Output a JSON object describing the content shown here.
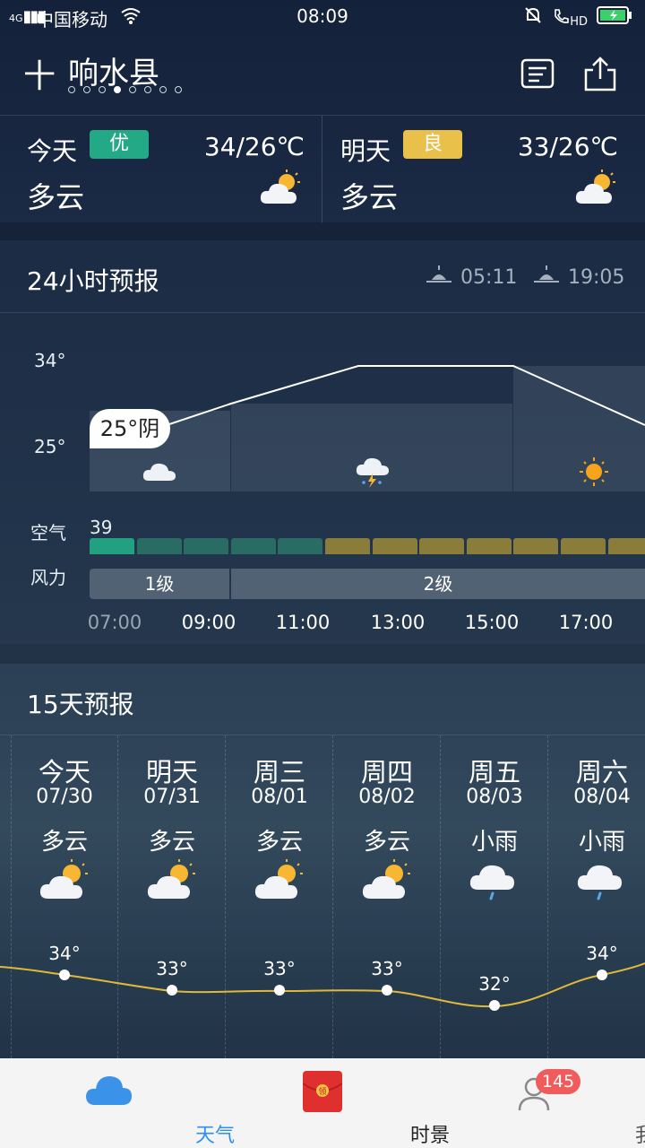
{
  "status": {
    "network": "4G",
    "carrier": "中国移动",
    "time": "08:09",
    "hd": "HD"
  },
  "header": {
    "city": "响水县",
    "page_count": 8,
    "active_page": 3
  },
  "today": {
    "label": "今天",
    "aqi_label": "优",
    "aqi_color": "#23a986",
    "temp": "34/26℃",
    "condition": "多云",
    "icon": "partly-cloudy-icon"
  },
  "tomorrow": {
    "label": "明天",
    "aqi_label": "良",
    "aqi_color": "#e8c04a",
    "temp": "33/26℃",
    "condition": "多云",
    "icon": "partly-cloudy-icon"
  },
  "hourly": {
    "title": "24小时预报",
    "sunrise": "05:11",
    "sunset": "19:05",
    "y_top": "34°",
    "y_bottom": "25°",
    "current_bubble": "25°阴",
    "air_label": "空气",
    "air_value": "39",
    "wind_label": "风力",
    "wind_1": "1级",
    "wind_2": "2级",
    "hours": [
      "07:00",
      "09:00",
      "11:00",
      "13:00",
      "15:00",
      "17:00"
    ],
    "air_colors": [
      "#21a17f",
      "#2a6b63",
      "#2a6b63",
      "#2a6b63",
      "#2a6b63",
      "#8a7d3b",
      "#8a7d3b",
      "#8a7d3b",
      "#8a7d3b",
      "#8a7d3b",
      "#8a7d3b",
      "#8a7d3b"
    ]
  },
  "daily": {
    "title": "15天预报",
    "days": [
      {
        "name": "今天",
        "date": "07/30",
        "cond": "多云",
        "icon": "partly-cloudy-icon",
        "high": "34°"
      },
      {
        "name": "明天",
        "date": "07/31",
        "cond": "多云",
        "icon": "partly-cloudy-icon",
        "high": "33°"
      },
      {
        "name": "周三",
        "date": "08/01",
        "cond": "多云",
        "icon": "partly-cloudy-icon",
        "high": "33°"
      },
      {
        "name": "周四",
        "date": "08/02",
        "cond": "多云",
        "icon": "partly-cloudy-icon",
        "high": "33°"
      },
      {
        "name": "周五",
        "date": "08/03",
        "cond": "小雨",
        "icon": "light-rain-icon",
        "high": "32°"
      },
      {
        "name": "周六",
        "date": "08/04",
        "cond": "小雨",
        "icon": "light-rain-icon",
        "high": "34°"
      }
    ]
  },
  "nav": {
    "weather": "天气",
    "scenery": "时景",
    "me": "我",
    "badge": "145",
    "active_color": "#2d8ff0"
  }
}
